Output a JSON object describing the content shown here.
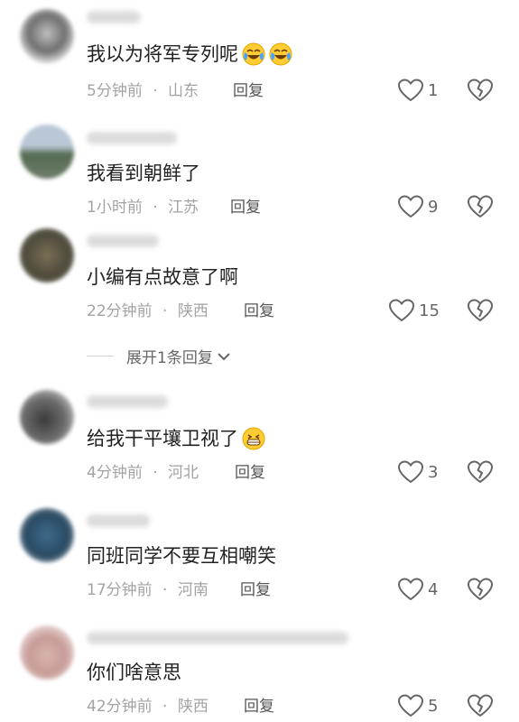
{
  "comments": [
    {
      "text": "我以为将军专列呢",
      "time": "5分钟前",
      "region": "山东",
      "reply": "回复",
      "likes": "1",
      "emojis": [
        "crying-laughing-emoji",
        "crying-laughing-emoji"
      ]
    },
    {
      "text": "我看到朝鲜了",
      "time": "1小时前",
      "region": "江苏",
      "reply": "回复",
      "likes": "9",
      "emojis": []
    },
    {
      "text": "小编有点故意了啊",
      "time": "22分钟前",
      "region": "陕西",
      "reply": "回复",
      "likes": "15",
      "emojis": []
    },
    {
      "text": "给我干平壤卫视了",
      "time": "4分钟前",
      "region": "河北",
      "reply": "回复",
      "likes": "3",
      "emojis": [
        "grinning-emoji"
      ]
    },
    {
      "text": "同班同学不要互相嘲笑",
      "time": "17分钟前",
      "region": "河南",
      "reply": "回复",
      "likes": "4",
      "emojis": []
    },
    {
      "text": "你们啥意思",
      "time": "42分钟前",
      "region": "陕西",
      "reply": "回复",
      "likes": "5",
      "emojis": []
    }
  ],
  "expand_replies": "展开1条回复",
  "separator": "·",
  "colors": {
    "meta": "#a3a3a3",
    "text": "#222222",
    "icon": "#666666"
  }
}
